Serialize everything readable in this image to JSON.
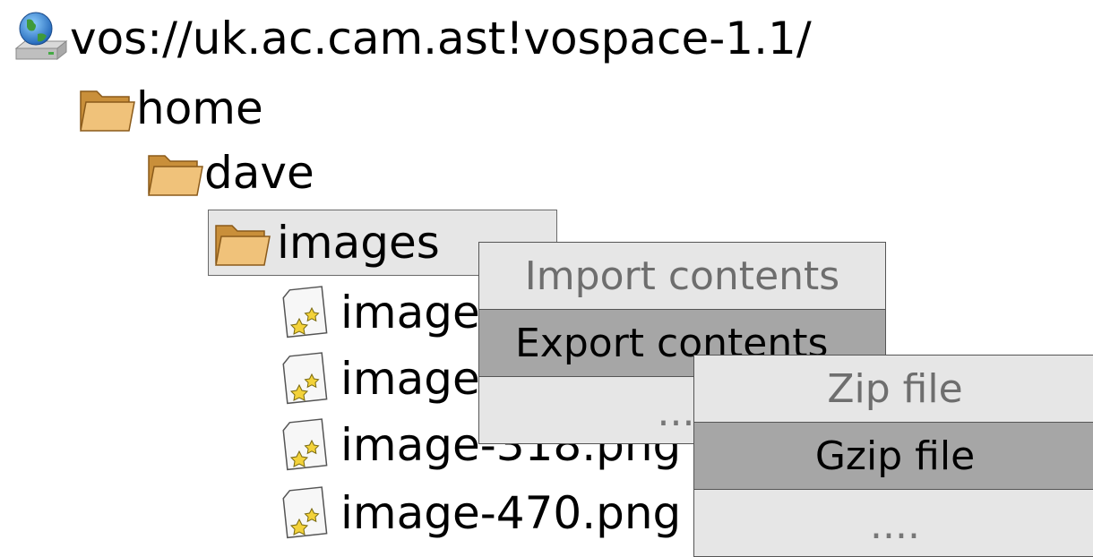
{
  "tree": {
    "root": {
      "label": "vos://uk.ac.cam.ast!vospace-1.1/",
      "icon": "network-drive-icon"
    },
    "home": {
      "label": "home",
      "icon": "folder-icon"
    },
    "dave": {
      "label": "dave",
      "icon": "folder-icon"
    },
    "images": {
      "label": "images",
      "icon": "folder-icon"
    },
    "files": [
      {
        "label": "image-",
        "icon": "image-file-icon"
      },
      {
        "label": "image-",
        "icon": "image-file-icon"
      },
      {
        "label": "image-318.png",
        "icon": "image-file-icon"
      },
      {
        "label": "image-470.png",
        "icon": "image-file-icon"
      }
    ]
  },
  "context_menu": {
    "items": [
      {
        "label": "Import contents",
        "state": "disabled"
      },
      {
        "label": "Export contents",
        "state": "highlighted"
      },
      {
        "label": "....",
        "state": "normal"
      }
    ]
  },
  "submenu": {
    "items": [
      {
        "label": "Zip file",
        "state": "disabled"
      },
      {
        "label": "Gzip file",
        "state": "highlighted"
      },
      {
        "label": "....",
        "state": "normal"
      }
    ]
  },
  "colors": {
    "selection_bg": "#e6e6e6",
    "highlight_bg": "#a6a6a6",
    "disabled_text": "#6e6e6e",
    "folder": "#e8b66a"
  }
}
